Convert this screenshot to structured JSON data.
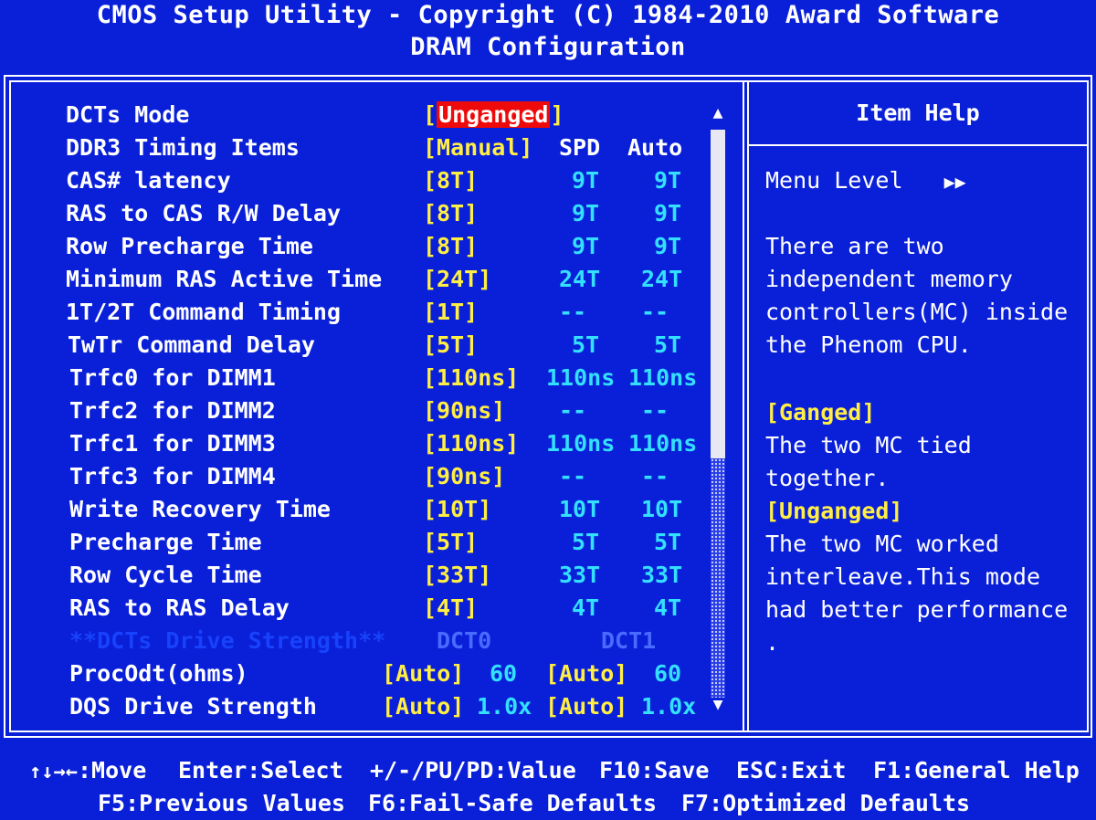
{
  "header": {
    "title": "CMOS Setup Utility - Copyright (C) 1984-2010 Award Software",
    "subtitle": "DRAM Configuration"
  },
  "menu": {
    "dcts_mode": {
      "label": "DCTs Mode",
      "value": "Unganged"
    },
    "ddr3_timing": {
      "label": "DDR3 Timing Items",
      "value": "[Manual]",
      "col_spd": "SPD",
      "col_auto": "Auto"
    },
    "rows": [
      {
        "label": "CAS# latency",
        "value": "[8T]",
        "spd": "9T",
        "auto": "9T"
      },
      {
        "label": "RAS to CAS R/W Delay",
        "value": "[8T]",
        "spd": "9T",
        "auto": "9T"
      },
      {
        "label": "Row Precharge Time",
        "value": "[8T]",
        "spd": "9T",
        "auto": "9T"
      },
      {
        "label": "Minimum RAS Active Time",
        "value": "[24T]",
        "spd": "24T",
        "auto": "24T"
      },
      {
        "label": "1T/2T Command Timing",
        "value": "[1T]",
        "spd": "--",
        "auto": "--"
      },
      {
        "label": "TwTr Command Delay",
        "value": "[5T]",
        "spd": "5T",
        "auto": "5T"
      },
      {
        "label": "Trfc0 for DIMM1",
        "value": "[110ns]",
        "spd": "110ns",
        "auto": "110ns"
      },
      {
        "label": "Trfc2 for DIMM2",
        "value": "[90ns]",
        "spd": "--",
        "auto": "--"
      },
      {
        "label": "Trfc1 for DIMM3",
        "value": "[110ns]",
        "spd": "110ns",
        "auto": "110ns"
      },
      {
        "label": "Trfc3 for DIMM4",
        "value": "[90ns]",
        "spd": "--",
        "auto": "--"
      },
      {
        "label": "Write Recovery Time",
        "value": "[10T]",
        "spd": "10T",
        "auto": "10T"
      },
      {
        "label": "Precharge Time",
        "value": "[5T]",
        "spd": "5T",
        "auto": "5T"
      },
      {
        "label": "Row Cycle Time",
        "value": "[33T]",
        "spd": "33T",
        "auto": "33T"
      },
      {
        "label": "RAS to RAS Delay",
        "value": "[4T]",
        "spd": "4T",
        "auto": "4T"
      }
    ],
    "drive_strength": {
      "label": "**DCTs Drive Strength**",
      "dct0": "DCT0",
      "dct1": "DCT1"
    },
    "procodt": {
      "label": "ProcOdt(ohms)",
      "v0": "[Auto]",
      "n0": "60",
      "v1": "[Auto]",
      "n1": "60"
    },
    "dqs": {
      "label": "DQS Drive Strength",
      "v0": "[Auto]",
      "n0": "1.0x",
      "v1": "[Auto]",
      "n1": "1.0x"
    }
  },
  "help": {
    "title": "Item Help",
    "menu_level": "Menu Level",
    "menu_level_icon": "▶▶",
    "lines": [
      "There are two",
      "independent memory",
      "controllers(MC) inside",
      "the Phenom CPU."
    ],
    "ganged_title": "[Ganged]",
    "ganged_lines": [
      "The two MC tied",
      "together."
    ],
    "unganged_title": "[Unganged]",
    "unganged_lines": [
      "The two MC worked",
      "interleave.This mode",
      "had better performance",
      "."
    ]
  },
  "footer": {
    "move_keys": "↑↓→←",
    "move": ":Move",
    "enter": "Enter:Select",
    "value": "+/-/PU/PD:Value",
    "save": "F10:Save",
    "exit": "ESC:Exit",
    "help": "F1:General Help",
    "prev": "F5:Previous Values",
    "failsafe": "F6:Fail-Safe Defaults",
    "optimized": "F7:Optimized Defaults"
  },
  "icons": {
    "scroll_up": "▲",
    "scroll_down": "▼"
  },
  "colors": {
    "background": "#0a20d8",
    "highlight": "#ee0a0a",
    "value_yellow": "#ffee44",
    "cyan": "#33e0ff"
  }
}
